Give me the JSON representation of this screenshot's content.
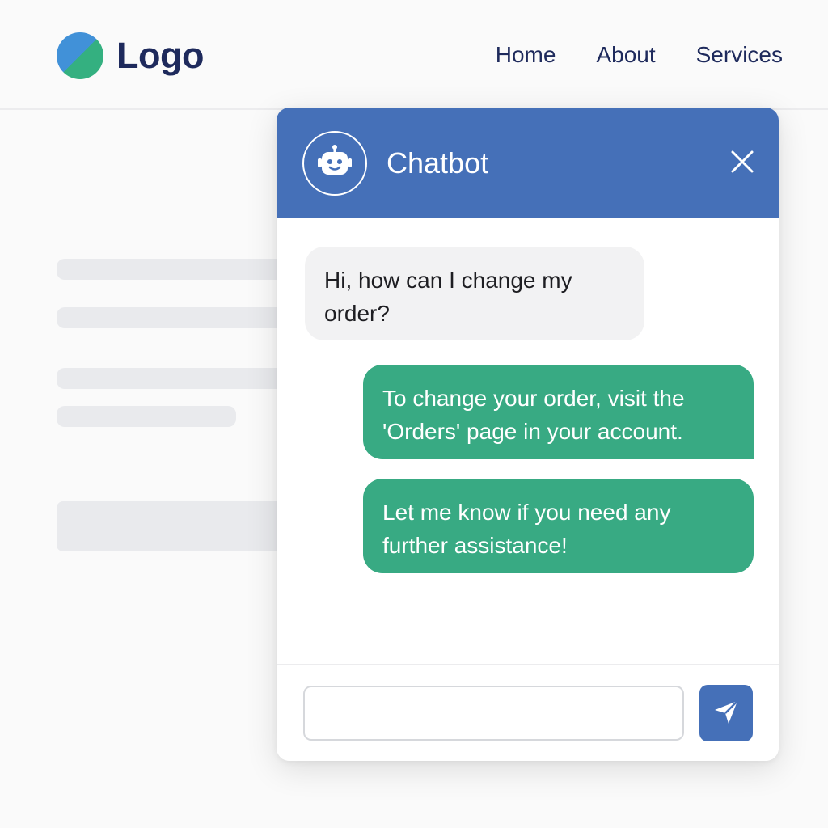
{
  "header": {
    "logo_text": "Logo",
    "nav": [
      "Home",
      "About",
      "Services"
    ]
  },
  "chat": {
    "title": "Chatbot",
    "messages": [
      {
        "role": "user",
        "text": "Hi, how can I change my order?"
      },
      {
        "role": "bot",
        "text": "To change your order, visit the 'Orders' page in your account."
      },
      {
        "role": "bot",
        "text": "Let me know if you need any further assistance!"
      }
    ],
    "input_placeholder": ""
  },
  "icons": {
    "logo": "logo-icon",
    "avatar": "robot-icon",
    "close": "close-icon",
    "send": "send-icon"
  },
  "colors": {
    "brand_navy": "#1e2a5c",
    "chat_header": "#4570b8",
    "bot_bubble": "#38aa83",
    "user_bubble": "#f2f2f3",
    "logo_blue": "#4191d8",
    "logo_green": "#34b080"
  }
}
